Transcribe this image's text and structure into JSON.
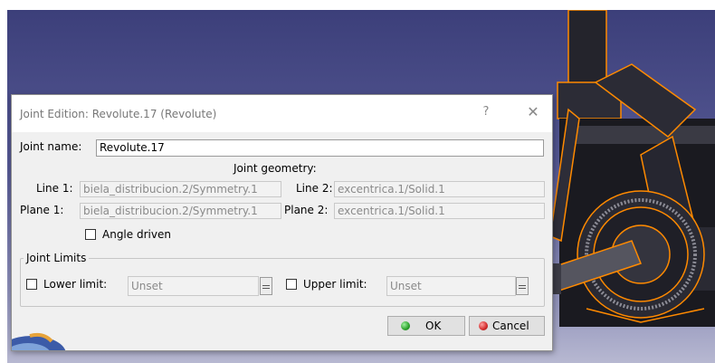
{
  "dialog": {
    "title": "Joint Edition: Revolute.17 (Revolute)",
    "help_icon": "?",
    "close_icon": "✕",
    "joint_name_label": "Joint name:",
    "joint_name_value": "Revolute.17",
    "joint_geometry_heading": "Joint geometry:",
    "line1_label": "Line 1:",
    "line1_value": "biela_distribucion.2/Symmetry.1",
    "line2_label": "Line 2:",
    "line2_value": "excentrica.1/Solid.1",
    "plane1_label": "Plane 1:",
    "plane1_value": "biela_distribucion.2/Symmetry.1",
    "plane2_label": "Plane 2:",
    "plane2_value": "excentrica.1/Solid.1",
    "angle_driven_label": "Angle driven",
    "joint_limits_label": "Joint Limits",
    "lower_limit_label": "Lower limit:",
    "lower_limit_value": "Unset",
    "upper_limit_label": "Upper limit:",
    "upper_limit_value": "Unset",
    "ok_label": "OK",
    "cancel_label": "Cancel"
  },
  "colors": {
    "viewport_top": "#3c3f7a",
    "viewport_bottom": "#b7b8d1",
    "highlight_orange": "#ff8a00",
    "ok_green": "#2aa02a",
    "cancel_red": "#d22a2a"
  },
  "icons": {
    "help": "help-icon",
    "close": "close-icon",
    "ok": "green-dot-icon",
    "cancel": "red-dot-icon",
    "spin": "spin-arrows-icon"
  }
}
